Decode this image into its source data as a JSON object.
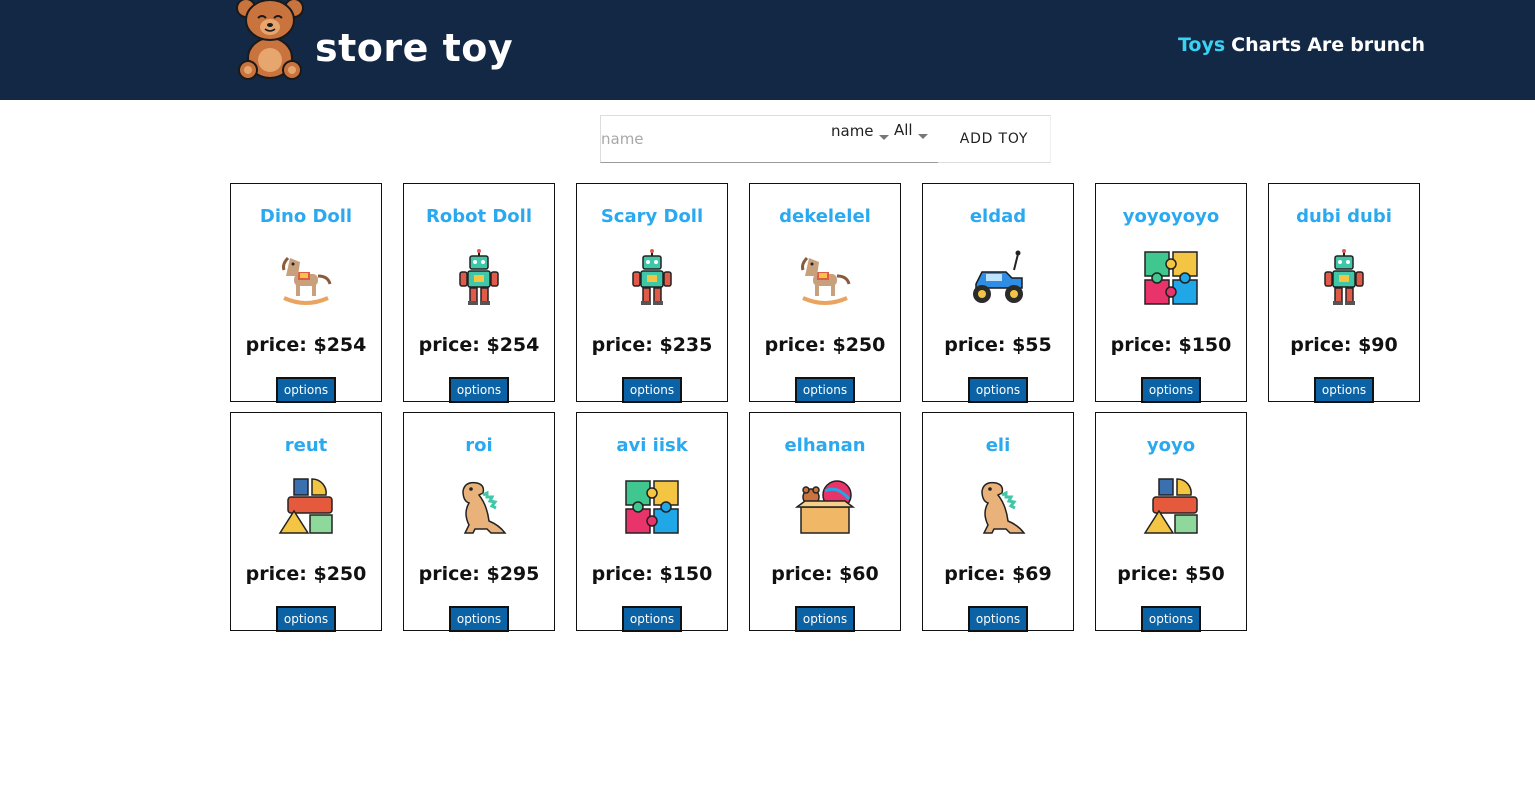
{
  "header": {
    "brand": "store toy",
    "logo_icon": "teddy-bear-icon",
    "nav": [
      {
        "label": "Toys",
        "active": true
      },
      {
        "label": "Charts",
        "active": false
      },
      {
        "label": "Are",
        "active": false
      },
      {
        "label": "brunch",
        "active": false
      }
    ]
  },
  "toolbar": {
    "search_placeholder": "name",
    "sort_select": "name",
    "category_select": "All",
    "add_label": "ADD TOY"
  },
  "toys": [
    {
      "name": "Dino Doll",
      "price": "price: $254",
      "icon": "rocking-horse-icon",
      "button": "options"
    },
    {
      "name": "Robot Doll",
      "price": "price: $254",
      "icon": "robot-icon",
      "button": "options"
    },
    {
      "name": "Scary Doll",
      "price": "price: $235",
      "icon": "robot-icon",
      "button": "options"
    },
    {
      "name": "dekelelel",
      "price": "price: $250",
      "icon": "rocking-horse-icon",
      "button": "options"
    },
    {
      "name": "eldad",
      "price": "price: $55",
      "icon": "rc-car-icon",
      "button": "options"
    },
    {
      "name": "yoyoyoyo",
      "price": "price: $150",
      "icon": "puzzle-icon",
      "button": "options"
    },
    {
      "name": "dubi dubi",
      "price": "price: $90",
      "icon": "robot-icon",
      "button": "options"
    },
    {
      "name": "reut",
      "price": "price: $250",
      "icon": "blocks-icon",
      "button": "options"
    },
    {
      "name": "roi",
      "price": "price: $295",
      "icon": "dinosaur-icon",
      "button": "options"
    },
    {
      "name": "avi iisk",
      "price": "price: $150",
      "icon": "puzzle-icon",
      "button": "options"
    },
    {
      "name": "elhanan",
      "price": "price: $60",
      "icon": "toy-box-icon",
      "button": "options"
    },
    {
      "name": "eli",
      "price": "price: $69",
      "icon": "dinosaur-icon",
      "button": "options"
    },
    {
      "name": "yoyo",
      "price": "price: $50",
      "icon": "blocks-icon",
      "button": "options"
    }
  ]
}
